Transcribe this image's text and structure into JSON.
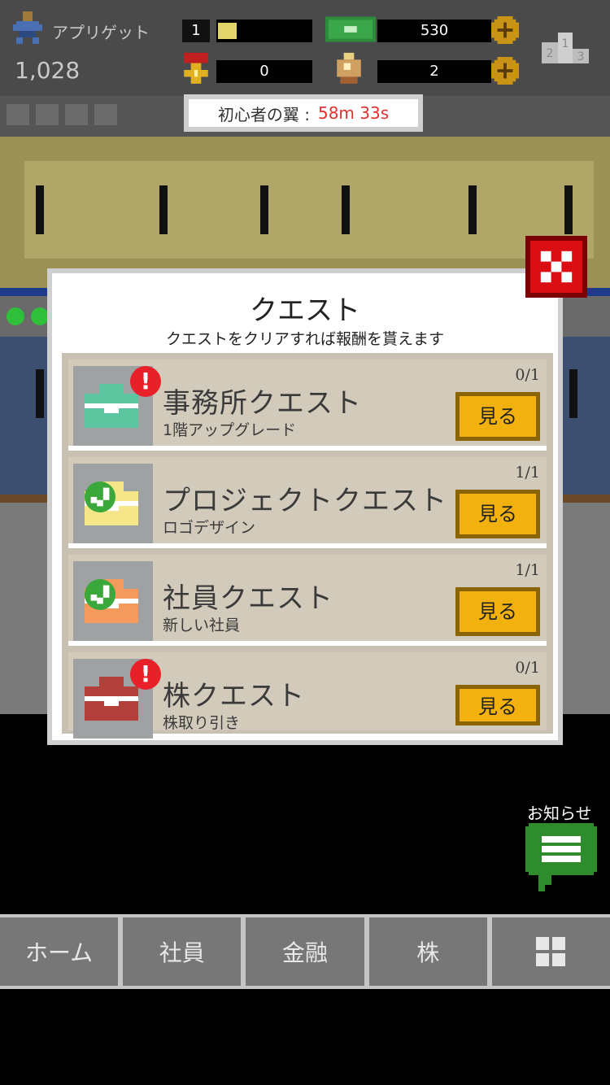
{
  "status": {
    "player_name": "アプリゲット",
    "money": "1,028",
    "level": "1",
    "xp_progress": 0.2,
    "medals": "0",
    "cash": "530",
    "gems": "2",
    "ranking_icon": "podium-icon"
  },
  "timer": {
    "label": "初心者の翼 :",
    "value": "58m 33s"
  },
  "modal": {
    "title": "クエスト",
    "subtitle": "クエストをクリアすれば報酬を貰えます",
    "quests": [
      {
        "title": "事務所クエスト",
        "desc": "1階アップグレード",
        "progress": "0/1",
        "button": "見る",
        "state": "alert",
        "icon_color": "#5bc5a0"
      },
      {
        "title": "プロジェクトクエスト",
        "desc": "ロゴデザイン",
        "progress": "1/1",
        "button": "見る",
        "state": "done",
        "icon_color": "#f6e68a"
      },
      {
        "title": "社員クエスト",
        "desc": "新しい社員",
        "progress": "1/1",
        "button": "見る",
        "state": "done",
        "icon_color": "#f39a5c"
      },
      {
        "title": "株クエスト",
        "desc": "株取り引き",
        "progress": "0/1",
        "button": "見る",
        "state": "alert",
        "icon_color": "#b3403b"
      }
    ]
  },
  "notice": {
    "label": "お知らせ"
  },
  "nav": {
    "home": "ホーム",
    "staff": "社員",
    "finance": "金融",
    "stock": "株",
    "menu_icon": "grid-icon"
  },
  "colors": {
    "accent_button": "#f2b10e",
    "close_red": "#d90d12",
    "timer_red": "#e23030"
  }
}
